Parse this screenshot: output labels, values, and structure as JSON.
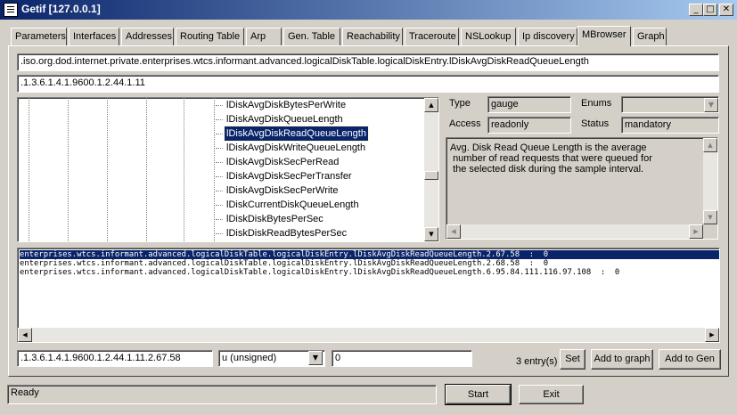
{
  "window": {
    "title": "Getif [127.0.0.1]",
    "minimize": "_",
    "maximize": "□",
    "close": "✕"
  },
  "tabs": [
    {
      "label": "Parameters"
    },
    {
      "label": "Interfaces"
    },
    {
      "label": "Addresses"
    },
    {
      "label": "Routing Table"
    },
    {
      "label": "Arp"
    },
    {
      "label": "Gen. Table"
    },
    {
      "label": "Reachability"
    },
    {
      "label": "Traceroute"
    },
    {
      "label": "NSLookup"
    },
    {
      "label": "Ip discovery"
    },
    {
      "label": "MBrowser",
      "active": true
    },
    {
      "label": "Graph"
    }
  ],
  "mbrowser": {
    "oid_name": ".iso.org.dod.internet.private.enterprises.wtcs.informant.advanced.logicalDiskTable.logicalDiskEntry.lDiskAvgDiskReadQueueLength",
    "oid_numeric": ".1.3.6.1.4.1.9600.1.2.44.1.11",
    "tree_items": [
      {
        "label": "lDiskAvgDiskBytesPerWrite"
      },
      {
        "label": "lDiskAvgDiskQueueLength"
      },
      {
        "label": "lDiskAvgDiskReadQueueLength",
        "selected": true
      },
      {
        "label": "lDiskAvgDiskWriteQueueLength"
      },
      {
        "label": "lDiskAvgDiskSecPerRead"
      },
      {
        "label": "lDiskAvgDiskSecPerTransfer"
      },
      {
        "label": "lDiskAvgDiskSecPerWrite"
      },
      {
        "label": "lDiskCurrentDiskQueueLength"
      },
      {
        "label": "lDiskDiskBytesPerSec"
      },
      {
        "label": "lDiskDiskReadBytesPerSec"
      }
    ],
    "props": {
      "type_label": "Type",
      "type_value": "gauge",
      "enums_label": "Enums",
      "enums_value": "",
      "access_label": "Access",
      "access_value": "readonly",
      "status_label": "Status",
      "status_value": "mandatory"
    },
    "description": "Avg. Disk Read Queue Length is the average\n number of read requests that were queued for\n the selected disk during the sample interval.",
    "results": [
      {
        "text": "enterprises.wtcs.informant.advanced.logicalDiskTable.logicalDiskEntry.lDiskAvgDiskReadQueueLength.2.67.58  :  0",
        "selected": true
      },
      {
        "text": "enterprises.wtcs.informant.advanced.logicalDiskTable.logicalDiskEntry.lDiskAvgDiskReadQueueLength.2.68.58  :  0"
      },
      {
        "text": "enterprises.wtcs.informant.advanced.logicalDiskTable.logicalDiskEntry.lDiskAvgDiskReadQueueLength.6.95.84.111.116.97.108  :  0"
      }
    ],
    "set_oid": ".1.3.6.1.4.1.9600.1.2.44.1.11.2.67.58",
    "set_type": "u (unsigned)",
    "set_value": "0",
    "entry_count": "3 entry(s)",
    "set_button": "Set",
    "add_graph_button": "Add to graph",
    "add_gen_button": "Add to Gen"
  },
  "footer": {
    "status": "Ready",
    "start_button": "Start",
    "exit_button": "Exit"
  },
  "colors": {
    "title_start": "#0a246a",
    "title_end": "#a6caf0",
    "face": "#d4d0c8",
    "selection": "#0a246a"
  }
}
